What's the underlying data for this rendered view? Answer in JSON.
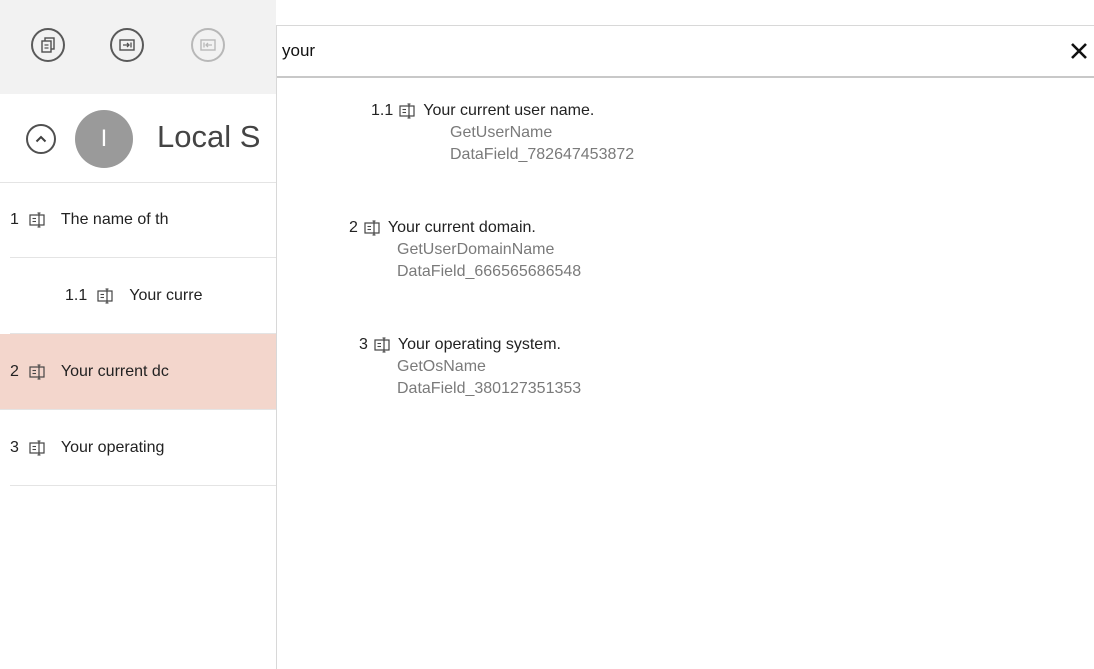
{
  "toolbar": {
    "buttons": [
      {
        "icon": "copy-fields-icon",
        "enabled": true
      },
      {
        "icon": "insert-field-icon",
        "enabled": true
      },
      {
        "icon": "remove-field-icon",
        "enabled": false
      }
    ]
  },
  "header": {
    "avatar_letter": "I",
    "title": "Local S"
  },
  "list": {
    "rows": [
      {
        "num": "1",
        "text": "The name of th",
        "selected": false
      },
      {
        "num": "1.1",
        "text": "Your curre",
        "selected": false
      },
      {
        "num": "2",
        "text": "Your current dc",
        "selected": true
      },
      {
        "num": "3",
        "text": "Your operating",
        "selected": false
      }
    ]
  },
  "search": {
    "value": "your",
    "clear_icon": "close-icon"
  },
  "results": [
    {
      "num": "1.1",
      "label": "Your current user name.",
      "method": "GetUserName",
      "field_id": "DataField_782647453872"
    },
    {
      "num": "2",
      "label": "Your current domain.",
      "method": "GetUserDomainName",
      "field_id": "DataField_666565686548"
    },
    {
      "num": "3",
      "label": "Your operating system.",
      "method": "GetOsName",
      "field_id": "DataField_380127351353"
    }
  ],
  "colors": {
    "selected_row": "#f3d6cc",
    "toolbar_bg": "#f2f2f2",
    "muted_text": "#7a7a7a"
  }
}
